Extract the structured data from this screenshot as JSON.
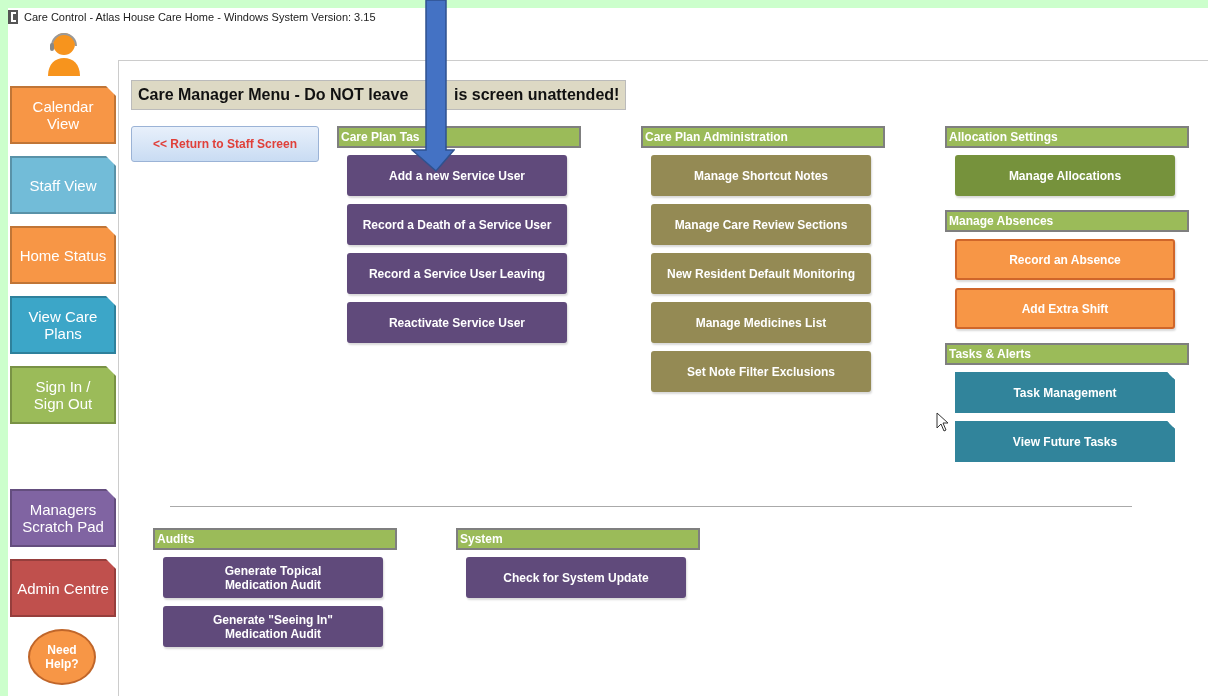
{
  "window": {
    "title": "Care Control - Atlas House Care Home - Windows System Version: 3.15"
  },
  "sidebar": {
    "items": [
      {
        "label": "Calendar\nView",
        "color": "#f79646"
      },
      {
        "label": "Staff View",
        "color": "#72bcd8"
      },
      {
        "label": "Home Status",
        "color": "#f79646"
      },
      {
        "label": "View Care\nPlans",
        "color": "#3ca6c8"
      },
      {
        "label": "Sign In /\nSign Out",
        "color": "#9bbb59"
      }
    ],
    "lower_items": [
      {
        "label": "Managers\nScratch Pad",
        "color": "#8064a2"
      },
      {
        "label": "Admin Centre",
        "color": "#c0504d"
      }
    ],
    "help": "Need\nHelp?"
  },
  "header": {
    "parts": [
      "Care Manager Menu - Do NOT leave",
      "is screen unattended!"
    ]
  },
  "return_button": "<< Return to Staff Screen",
  "columns": [
    {
      "sections": [
        {
          "title": "Care Plan Tas",
          "buttons": [
            {
              "label": "Add a new Service User",
              "kind": "task"
            },
            {
              "label": "Record a Death of a Service User",
              "kind": "task"
            },
            {
              "label": "Record a Service User Leaving",
              "kind": "task"
            },
            {
              "label": "Reactivate Service User",
              "kind": "task"
            }
          ]
        }
      ]
    },
    {
      "sections": [
        {
          "title": "Care Plan Administration",
          "buttons": [
            {
              "label": "Manage Shortcut Notes",
              "kind": "admin"
            },
            {
              "label": "Manage Care Review Sections",
              "kind": "admin"
            },
            {
              "label": "New Resident Default Monitoring",
              "kind": "admin"
            },
            {
              "label": "Manage Medicines List",
              "kind": "admin"
            },
            {
              "label": "Set Note Filter Exclusions",
              "kind": "admin"
            }
          ]
        }
      ]
    },
    {
      "sections": [
        {
          "title": "Allocation Settings",
          "buttons": [
            {
              "label": "Manage Allocations",
              "kind": "allocation"
            }
          ]
        },
        {
          "title": "Manage Absences",
          "buttons": [
            {
              "label": "Record an Absence",
              "kind": "absence"
            },
            {
              "label": "Add Extra Shift",
              "kind": "absence"
            }
          ]
        },
        {
          "title": "Tasks & Alerts",
          "buttons": [
            {
              "label": "Task Management",
              "kind": "alert"
            },
            {
              "label": "View Future Tasks",
              "kind": "alert"
            }
          ]
        }
      ]
    }
  ],
  "bottom_sections": [
    {
      "title": "Audits",
      "buttons": [
        {
          "label": "Generate Topical\nMedication Audit",
          "kind": "task"
        },
        {
          "label": "Generate \"Seeing In\"\nMedication Audit",
          "kind": "task"
        }
      ]
    },
    {
      "title": "System",
      "buttons": [
        {
          "label": "Check for System Update",
          "kind": "task"
        }
      ]
    }
  ]
}
